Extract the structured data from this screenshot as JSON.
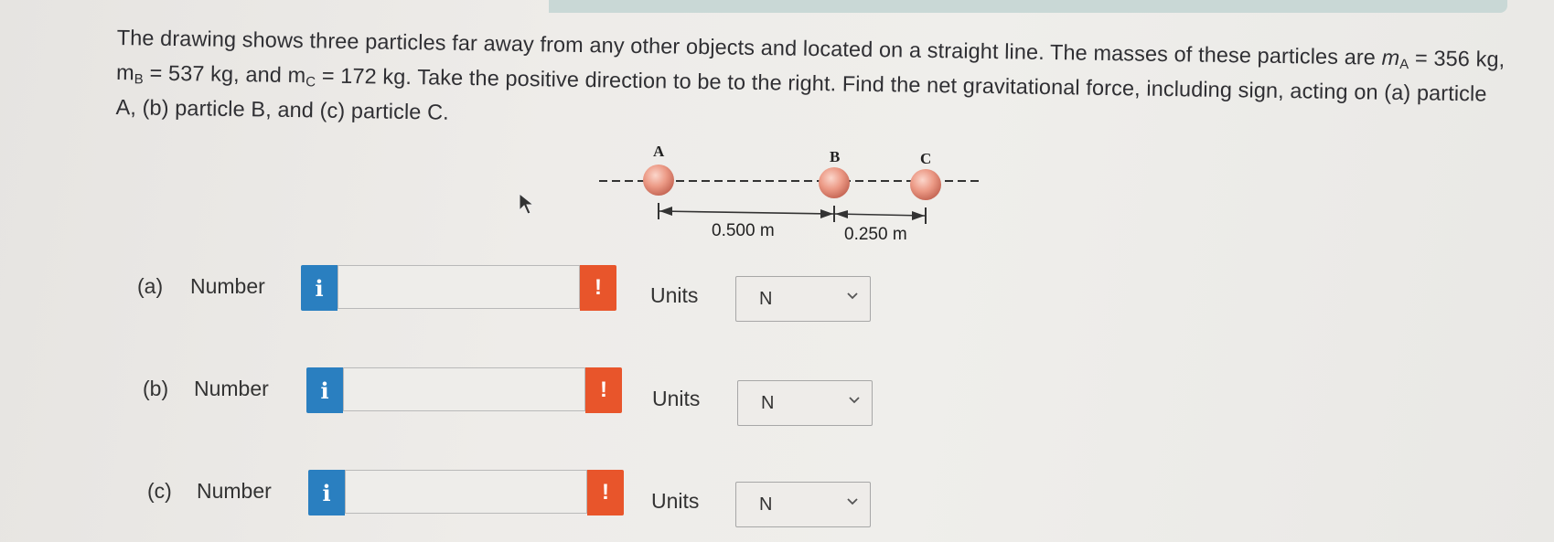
{
  "question": {
    "part1": "The drawing shows three particles far away from any other objects and located on a straight line. The masses of these particles are ",
    "mA_var": "m",
    "mA_sub": "A",
    "mA_val": " = 356 kg, ",
    "mB_var": "m",
    "mB_sub": "B",
    "mB_val": " = 537 kg, and ",
    "mC_var": "m",
    "mC_sub": "C",
    "mC_val": " = 172 kg. Take the positive direction to be to the right. Find the net gravitational force, including sign, acting on (a) particle A, (b) particle B, and (c) particle C."
  },
  "diagram": {
    "labels": {
      "a": "A",
      "b": "B",
      "c": "C"
    },
    "dist_ab": "0.500 m",
    "dist_bc": "0.250 m",
    "particle_color": "#e8917f",
    "line_color": "#333333"
  },
  "answers": [
    {
      "part": "(a)",
      "label": "Number",
      "value": "",
      "units_label": "Units",
      "unit": "N"
    },
    {
      "part": "(b)",
      "label": "Number",
      "value": "",
      "units_label": "Units",
      "unit": "N"
    },
    {
      "part": "(c)",
      "label": "Number",
      "value": "",
      "units_label": "Units",
      "unit": "N"
    }
  ],
  "icons": {
    "info": "i",
    "warning": "!"
  },
  "colors": {
    "info_button": "#2a7fc0",
    "warning_button": "#e8552b"
  }
}
